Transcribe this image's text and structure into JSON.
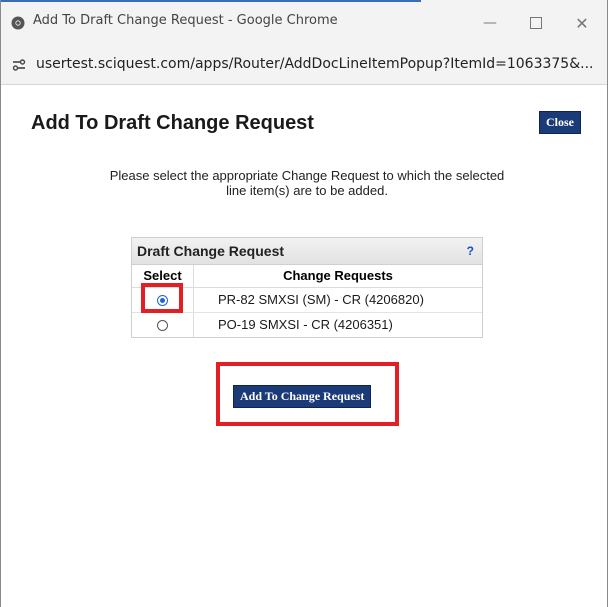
{
  "window": {
    "title": "Add To Draft Change Request - Google Chrome",
    "url": "usertest.sciquest.com/apps/Router/AddDocLineItemPopup?ItemId=1063375&..."
  },
  "page": {
    "title": "Add To Draft Change Request",
    "close_label": "Close",
    "instructions": "Please select the appropriate Change Request to which the selected line item(s) are to be added."
  },
  "table": {
    "header": "Draft Change Request",
    "help": "?",
    "columns": [
      "Select",
      "Change Requests"
    ],
    "rows": [
      {
        "label": "PR-82 SMXSI (SM) - CR (4206820)",
        "selected": true
      },
      {
        "label": "PO-19 SMXSI - CR (4206351)",
        "selected": false
      }
    ]
  },
  "actions": {
    "add_label": "Add To Change Request"
  },
  "colors": {
    "button_bg": "#1b3a78",
    "highlight": "#e31e24",
    "radio_selected": "#1a66d9"
  }
}
